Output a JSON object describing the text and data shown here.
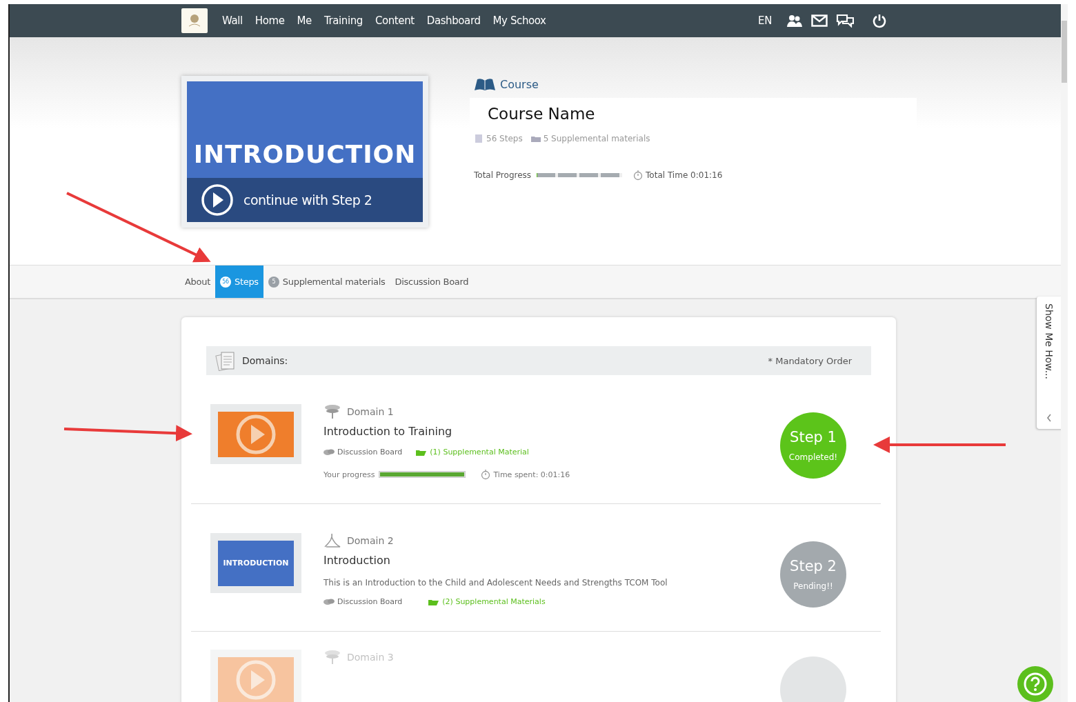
{
  "nav": {
    "items": [
      {
        "label": "Wall",
        "selected": false
      },
      {
        "label": "Home",
        "selected": false
      },
      {
        "label": "Me",
        "selected": false
      },
      {
        "label": "Training",
        "selected": false
      },
      {
        "label": "Content",
        "selected": false
      },
      {
        "label": "Dashboard",
        "selected": false
      },
      {
        "label": "My Schoox",
        "selected": false
      }
    ],
    "language": "EN"
  },
  "course": {
    "hero_title": "INTRODUCTION",
    "continue": "continue with Step 2",
    "label": "Course",
    "name": "Course Name",
    "steps": "56 Steps",
    "supplemental": "5 Supplemental materials",
    "progress_label": "Total Progress",
    "level": 0.01,
    "total_time": "Total Time 0:01:16"
  },
  "tabs": [
    {
      "label": "About",
      "selected": false
    },
    {
      "badge": "56",
      "label": "Steps",
      "selected": true
    },
    {
      "badge": "5",
      "label": "Supplemental materials",
      "selected": false
    },
    {
      "label": "Discussion Board",
      "selected": false
    }
  ],
  "domains": {
    "title": "Domains:",
    "note": "* Mandatory Order",
    "items": [
      {
        "domain": "Domain 1",
        "title": "Introduction to Training",
        "discussion": "Discussion Board",
        "supplemental": "(1) Supplemental Material",
        "progress_label": "Your progress",
        "level": 1,
        "time": "Time spent: 0:01:16",
        "step": "Step 1",
        "status": "Completed!",
        "kind": "completed"
      },
      {
        "thumb_text": "INTRODUCTION",
        "domain": "Domain 2",
        "title": "Introduction",
        "description": "This is an Introduction to the Child and Adolescent Needs and Strengths TCOM Tool",
        "discussion": "Discussion Board",
        "supplemental": "(2) Supplemental Materials",
        "step": "Step 2",
        "status": "Pending!!",
        "kind": "pending"
      },
      {
        "domain": "Domain 3",
        "kind": "faded"
      }
    ]
  },
  "show_me": {
    "label": "Show Me How..."
  }
}
